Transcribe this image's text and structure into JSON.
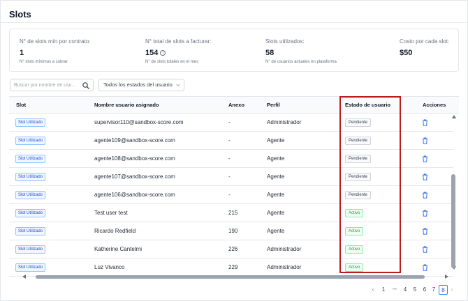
{
  "page": {
    "title": "Slots"
  },
  "stats": [
    {
      "label": "N° de slots mín por contrato:",
      "value": "1",
      "sub": "N° slots mínimos a cobrar"
    },
    {
      "label": "N° total de slots a facturar:",
      "value": "154",
      "sub": "N° de slots totales en el mes"
    },
    {
      "label": "Slots utilizados:",
      "value": "58",
      "sub": "N° de usuarios actuales en plataforma"
    },
    {
      "label": "Costo por cada slot:",
      "value": "$50",
      "sub": ""
    }
  ],
  "search": {
    "placeholder": "Buscar por nombre de usu..."
  },
  "filter": {
    "selected": "Todos los estados del usuario"
  },
  "table": {
    "headers": {
      "slot": "Slot",
      "nombre": "Nombre usuario asignado",
      "anexo": "Anexo",
      "perfil": "Perfil",
      "estado": "Estado de usuario",
      "acciones": "Acciones"
    },
    "rows": [
      {
        "slot": "Slot Utilizado",
        "nombre": "supervisor110@sandbox-score.com",
        "anexo": "-",
        "perfil": "Administrador",
        "estado": "Pendiente"
      },
      {
        "slot": "Slot Utilizado",
        "nombre": "agente109@sandbox-score.com",
        "anexo": "-",
        "perfil": "Agente",
        "estado": "Pendiente"
      },
      {
        "slot": "Slot Utilizado",
        "nombre": "agente108@sandbox-score.com",
        "anexo": "-",
        "perfil": "Agente",
        "estado": "Pendiente"
      },
      {
        "slot": "Slot Utilizado",
        "nombre": "agente107@sandbox-score.com",
        "anexo": "-",
        "perfil": "Agente",
        "estado": "Pendiente"
      },
      {
        "slot": "Slot Utilizado",
        "nombre": "agente106@sandbox-score.com",
        "anexo": "-",
        "perfil": "Agente",
        "estado": "Pendiente"
      },
      {
        "slot": "Slot Utilizado",
        "nombre": "Test user test",
        "anexo": "215",
        "perfil": "Agente",
        "estado": "Activo"
      },
      {
        "slot": "Slot Utilizado",
        "nombre": "Ricardo Redfield",
        "anexo": "190",
        "perfil": "Agente",
        "estado": "Activo"
      },
      {
        "slot": "Slot Utilizado",
        "nombre": "Katherine Cantelmi",
        "anexo": "226",
        "perfil": "Administrador",
        "estado": "Activo"
      },
      {
        "slot": "Slot Utilizado",
        "nombre": "Luz Vivanco",
        "anexo": "229",
        "perfil": "Administrador",
        "estado": "Activo"
      }
    ]
  },
  "pagination": {
    "prev": "‹",
    "pages": [
      "1",
      "•••",
      "4",
      "5",
      "6",
      "7",
      "8"
    ],
    "current": "8",
    "next": "›"
  },
  "colors": {
    "highlight": "#b91c1c",
    "slot_tag": "#1d4ed8",
    "activo": "#16a34a",
    "active_page": "#2563eb"
  }
}
